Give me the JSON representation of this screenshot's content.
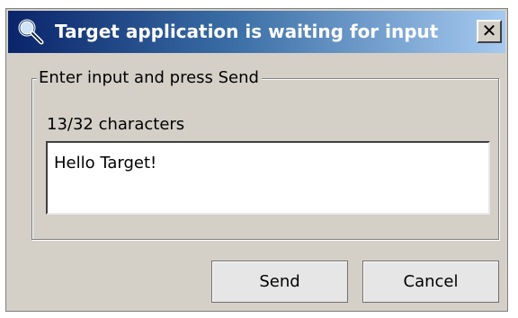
{
  "window": {
    "title": "Target application is waiting for input",
    "title_icon": "magnifier-icon",
    "close_label": "✕"
  },
  "form": {
    "group_label": "Enter input and press Send",
    "char_count": "13/32 characters",
    "input_value": "Hello Target!"
  },
  "buttons": {
    "send_label": "Send",
    "cancel_label": "Cancel"
  },
  "colors": {
    "title_gradient_start": "#0a246a",
    "title_gradient_end": "#a6caf0",
    "dialog_background": "#d4d0c8"
  }
}
